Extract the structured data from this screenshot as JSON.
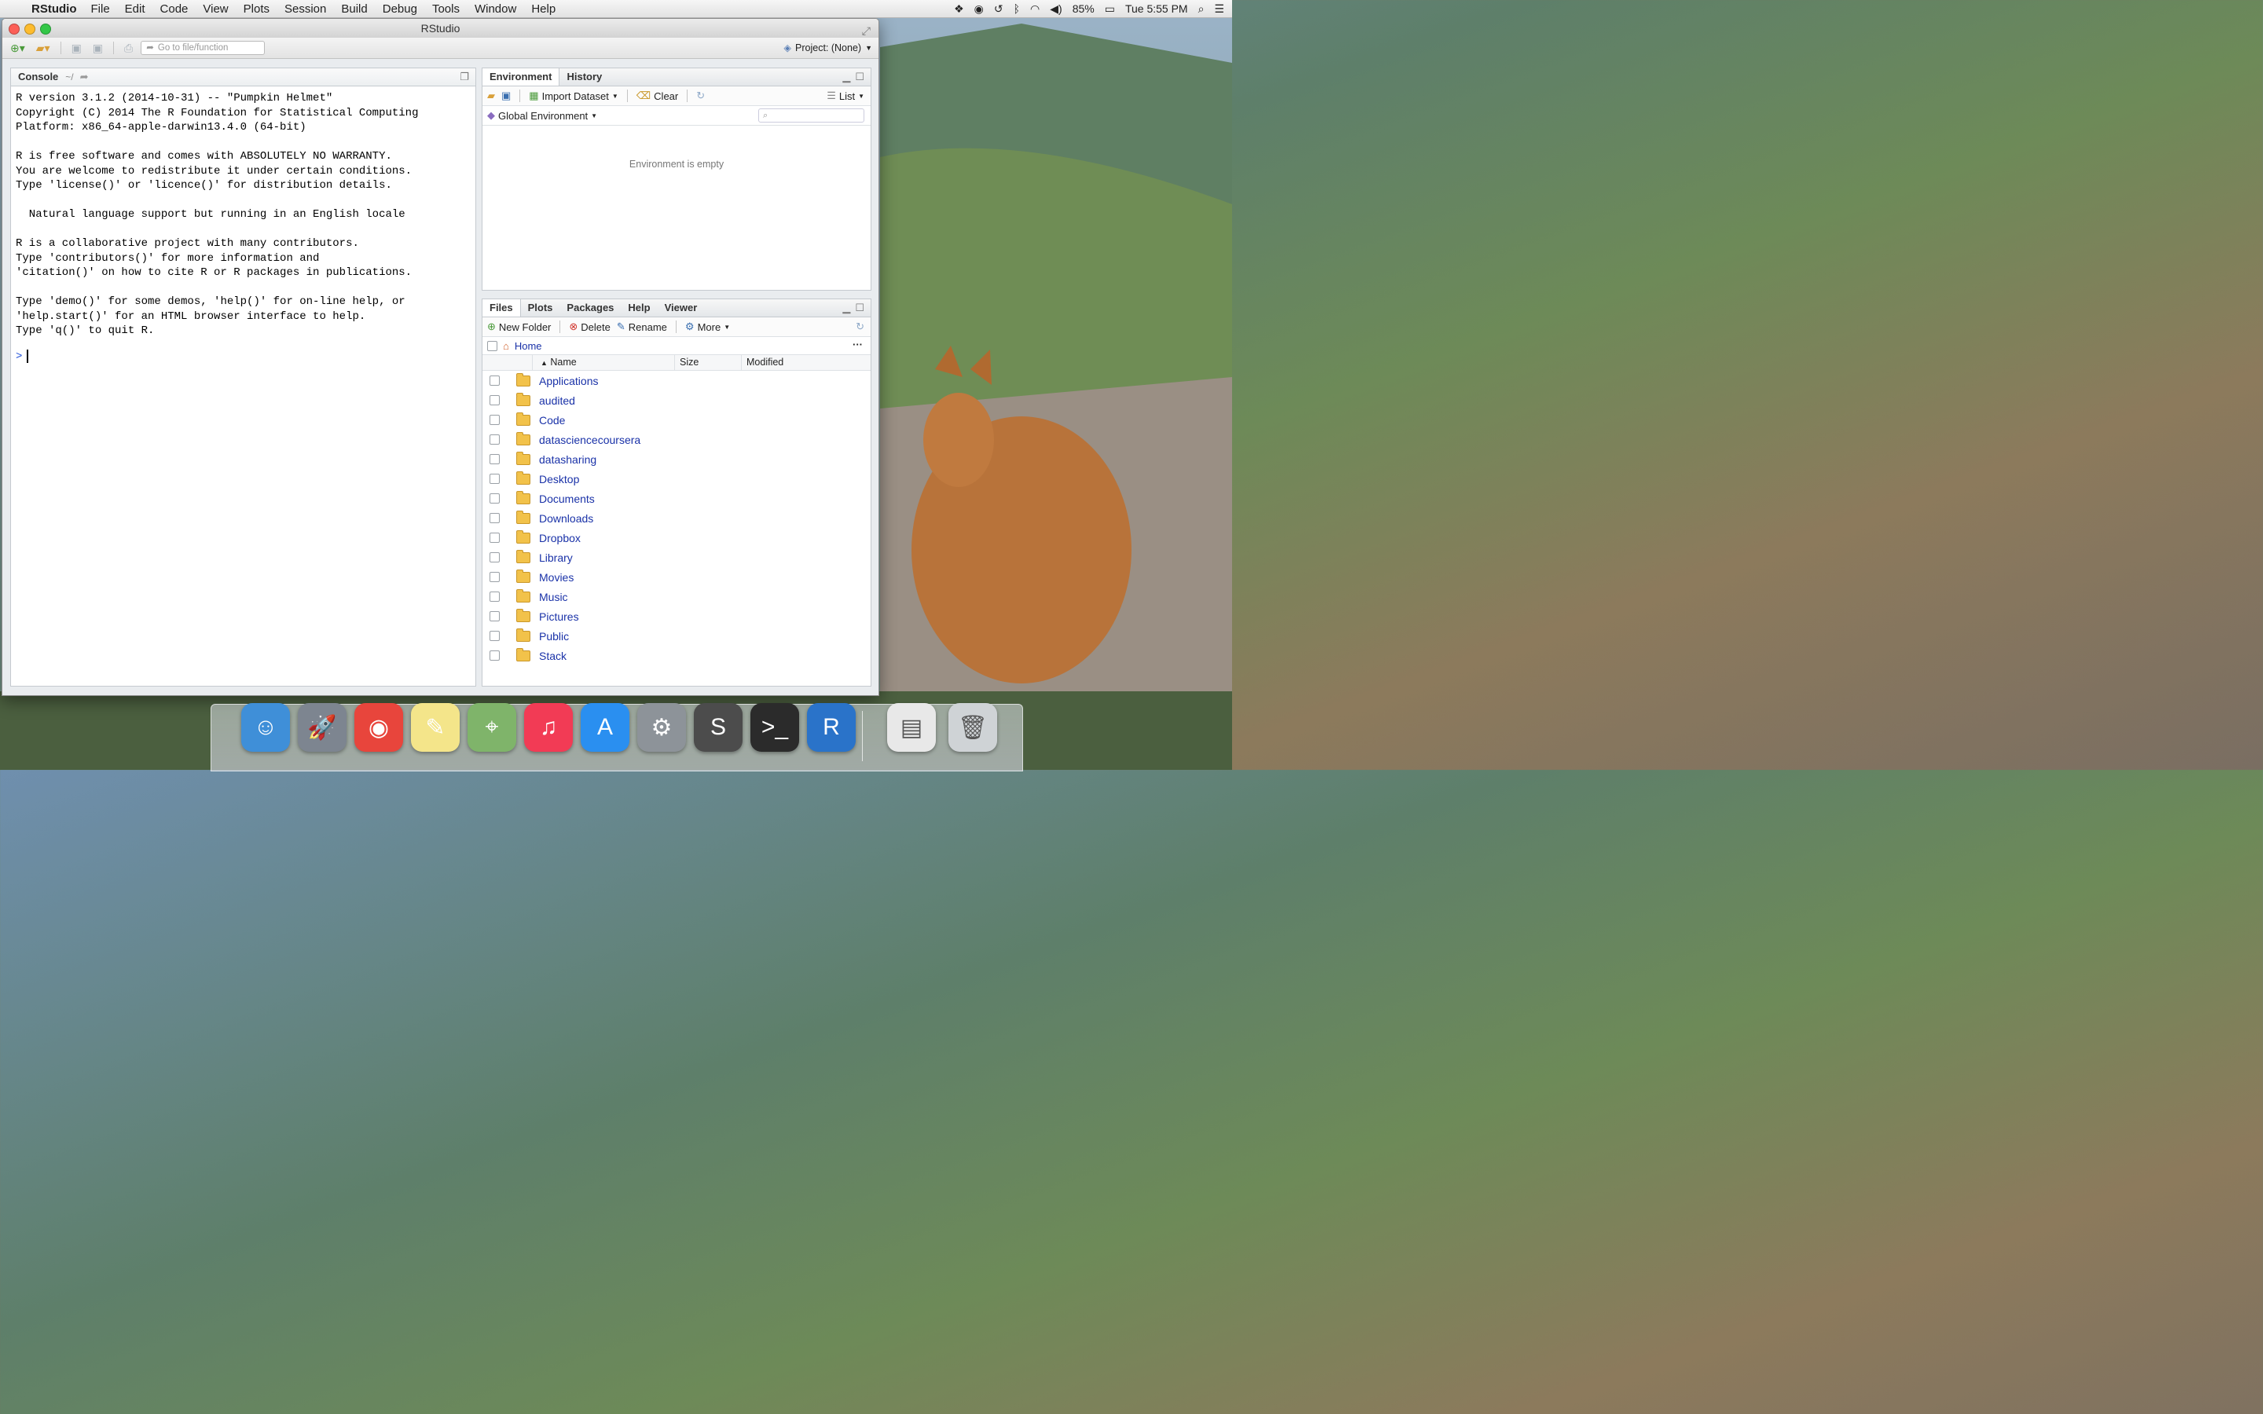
{
  "menubar": {
    "app_name": "RStudio",
    "menus": [
      "File",
      "Edit",
      "Code",
      "View",
      "Plots",
      "Session",
      "Build",
      "Debug",
      "Tools",
      "Window",
      "Help"
    ],
    "battery": "85%",
    "clock": "Tue 5:55 PM"
  },
  "window": {
    "title": "RStudio",
    "goto_placeholder": "Go to file/function",
    "project_label": "Project: (None)"
  },
  "console": {
    "tab_label": "Console",
    "path": "~/",
    "output": "R version 3.1.2 (2014-10-31) -- \"Pumpkin Helmet\"\nCopyright (C) 2014 The R Foundation for Statistical Computing\nPlatform: x86_64-apple-darwin13.4.0 (64-bit)\n\nR is free software and comes with ABSOLUTELY NO WARRANTY.\nYou are welcome to redistribute it under certain conditions.\nType 'license()' or 'licence()' for distribution details.\n\n  Natural language support but running in an English locale\n\nR is a collaborative project with many contributors.\nType 'contributors()' for more information and\n'citation()' on how to cite R or R packages in publications.\n\nType 'demo()' for some demos, 'help()' for on-line help, or\n'help.start()' for an HTML browser interface to help.\nType 'q()' to quit R.",
    "prompt": ">"
  },
  "environment": {
    "tabs": [
      "Environment",
      "History"
    ],
    "import_label": "Import Dataset",
    "clear_label": "Clear",
    "view_label": "List",
    "scope_label": "Global Environment",
    "empty_message": "Environment is empty"
  },
  "files": {
    "tabs": [
      "Files",
      "Plots",
      "Packages",
      "Help",
      "Viewer"
    ],
    "new_folder_label": "New Folder",
    "delete_label": "Delete",
    "rename_label": "Rename",
    "more_label": "More",
    "path_home": "Home",
    "columns": {
      "name": "Name",
      "size": "Size",
      "modified": "Modified"
    },
    "items": [
      {
        "name": "Applications"
      },
      {
        "name": "audited"
      },
      {
        "name": "Code"
      },
      {
        "name": "datasciencecoursera"
      },
      {
        "name": "datasharing"
      },
      {
        "name": "Desktop"
      },
      {
        "name": "Documents"
      },
      {
        "name": "Downloads"
      },
      {
        "name": "Dropbox"
      },
      {
        "name": "Library"
      },
      {
        "name": "Movies"
      },
      {
        "name": "Music"
      },
      {
        "name": "Pictures"
      },
      {
        "name": "Public"
      },
      {
        "name": "Stack"
      }
    ]
  },
  "dock": {
    "apps": [
      {
        "name": "finder-icon",
        "color": "#3f8fd8",
        "glyph": "☺"
      },
      {
        "name": "launchpad-icon",
        "color": "#7d8590",
        "glyph": "🚀"
      },
      {
        "name": "chrome-icon",
        "color": "#e8453c",
        "glyph": "◉"
      },
      {
        "name": "stickies-icon",
        "color": "#f4e58a",
        "glyph": "✎"
      },
      {
        "name": "maps-icon",
        "color": "#7fb46a",
        "glyph": "⌖"
      },
      {
        "name": "itunes-icon",
        "color": "#f23b55",
        "glyph": "♫"
      },
      {
        "name": "app-store-icon",
        "color": "#2a8ff0",
        "glyph": "A"
      },
      {
        "name": "system-preferences-icon",
        "color": "#8d9399",
        "glyph": "⚙"
      },
      {
        "name": "sublime-text-icon",
        "color": "#4c4c4c",
        "glyph": "S"
      },
      {
        "name": "terminal-icon",
        "color": "#2b2b2b",
        "glyph": ">_"
      },
      {
        "name": "r-icon",
        "color": "#2a73c9",
        "glyph": "R"
      }
    ],
    "extras": [
      {
        "name": "downloads-stack-icon",
        "color": "#e8e8e8",
        "glyph": "▤"
      },
      {
        "name": "trash-icon",
        "color": "#cfd3d6",
        "glyph": "🗑"
      }
    ]
  }
}
